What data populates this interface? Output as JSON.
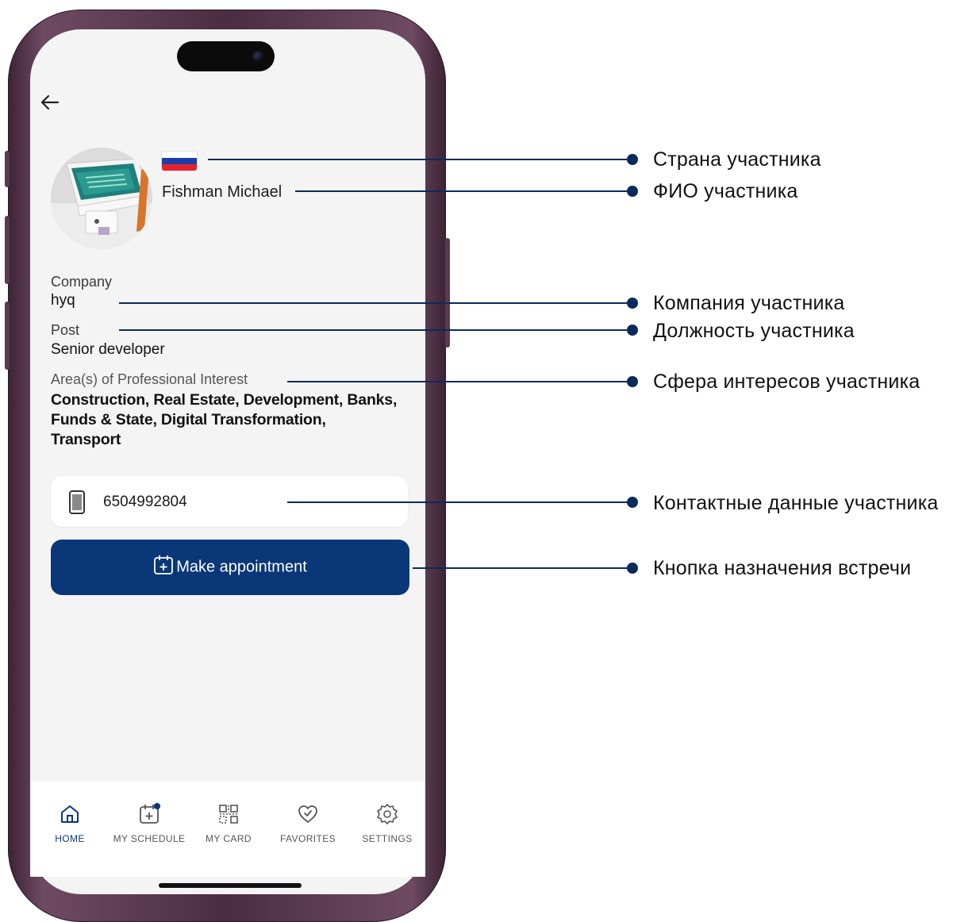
{
  "profile": {
    "name": "Fishman Michael",
    "company_label": "Company",
    "company_value": "hyq",
    "post_label": "Post",
    "post_value": "Senior developer",
    "interest_label": "Area(s) of Professional Interest",
    "interest_value": "Construction, Real Estate, Development, Banks, Funds & State, Digital Transformation, Transport",
    "phone": "6504992804",
    "flag_colors": [
      "#ffffff",
      "#1c3faa",
      "#e4222b"
    ]
  },
  "actions": {
    "make_appointment": "Make appointment"
  },
  "tabbar": {
    "items": [
      {
        "label": "HOME",
        "icon": "home-icon",
        "active": true
      },
      {
        "label": "MY SCHEDULE",
        "icon": "calendar-add-icon",
        "active": false
      },
      {
        "label": "MY CARD",
        "icon": "qr-code-icon",
        "active": false
      },
      {
        "label": "FAVORITES",
        "icon": "heart-check-icon",
        "active": false
      },
      {
        "label": "SETTINGS",
        "icon": "gear-icon",
        "active": false
      }
    ]
  },
  "annotations": {
    "country": "Страна участника",
    "name": "ФИО участника",
    "company": "Компания участника",
    "post": "Должность участника",
    "interests": "Сфера интересов участника",
    "contacts": "Контактные данные участника",
    "appointment": "Кнопка назначения встречи"
  },
  "colors": {
    "primary": "#0a3778",
    "callout": "#0a2a5e",
    "screen_bg": "#f4f4f4",
    "notification_dot": "#0a3778"
  }
}
